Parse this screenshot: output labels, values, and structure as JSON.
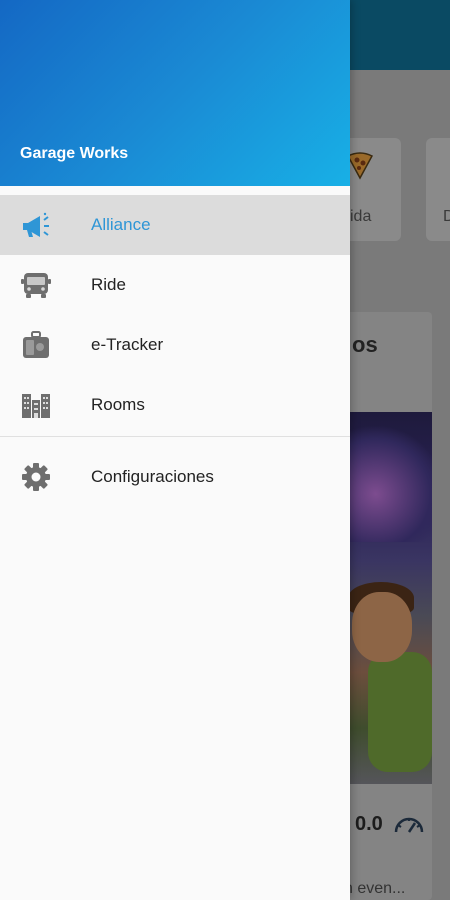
{
  "background": {
    "card_labels": [
      "ida",
      "D"
    ],
    "panel_title": "os",
    "rating": "0.0",
    "footer_text": "n even..."
  },
  "drawer": {
    "title": "Garage Works",
    "items": [
      {
        "label": "Alliance",
        "icon": "megaphone-icon",
        "active": true
      },
      {
        "label": "Ride",
        "icon": "bus-icon"
      },
      {
        "label": "e-Tracker",
        "icon": "luggage-icon"
      },
      {
        "label": "Rooms",
        "icon": "buildings-icon"
      }
    ],
    "settings": {
      "label": "Configuraciones",
      "icon": "gear-icon"
    }
  },
  "colors": {
    "header_start": "#1468c4",
    "header_end": "#18b0e6",
    "active_text": "#2f96d6",
    "active_bg": "#dcdcdc"
  }
}
